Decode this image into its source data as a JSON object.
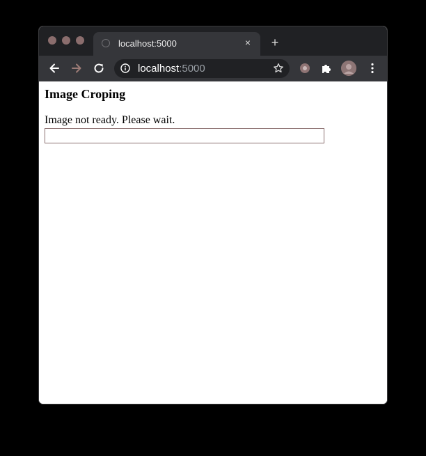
{
  "browser": {
    "tab": {
      "title": "localhost:5000",
      "close_label": "×"
    },
    "new_tab_label": "+",
    "address": {
      "host": "localhost",
      "port": ":5000"
    }
  },
  "page": {
    "title": "Image Croping",
    "status": "Image not ready. Please wait."
  },
  "icons": {
    "back": "arrow-left-icon",
    "forward": "arrow-right-icon",
    "reload": "reload-icon",
    "info": "info-icon",
    "bookmark": "star-icon",
    "extension": "extension-icon",
    "extensions_menu": "puzzle-icon",
    "profile": "avatar",
    "menu": "kebab-menu-icon"
  },
  "colors": {
    "titlebar": "#202124",
    "toolbar": "#35363a",
    "traffic_lights": "#8a6d6d",
    "crop_box_border": "#8b6f6f"
  }
}
